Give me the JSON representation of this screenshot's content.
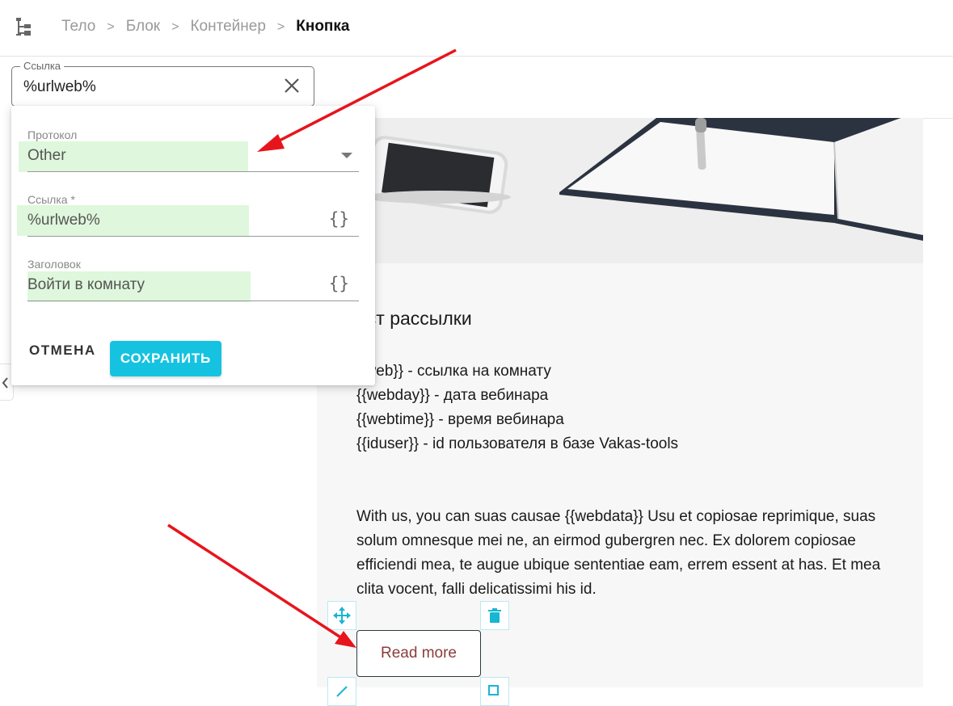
{
  "breadcrumb": {
    "items": [
      "Тело",
      "Блок",
      "Контейнер"
    ],
    "current": "Кнопка",
    "separator": ">"
  },
  "link_field": {
    "legend": "Ссылка",
    "value": "%urlweb%"
  },
  "popup": {
    "protocol": {
      "label": "Протокол",
      "value": "Other"
    },
    "link": {
      "label": "Ссылка *",
      "value": "%urlweb%",
      "brace": "{}"
    },
    "title": {
      "label": "Заголовок",
      "value": "Войти в комнату",
      "brace": "{}"
    },
    "cancel_label": "ОТМЕНА",
    "save_label": "СОХРАНИТЬ"
  },
  "content": {
    "heading": "ест рассылки",
    "vars": [
      "rlweb}} - ссылка на комнату",
      "{{webday}} - дата вебинара",
      "{{webtime}} - время вебинара",
      "{{iduser}} - id пользователя в базе Vakas-tools"
    ],
    "paragraph": "With us, you can suas causae {{webdata}} Usu et copiosae reprimique, suas solum omnesque mei ne, an eirmod gubergren nec. Ex dolorem copiosae efficiendi mea, te augue ubique sententiae eam, errem essent at has. Et mea clita vocent, falli delicatissimi his id.",
    "button_label": "Read more"
  },
  "colors": {
    "accent": "#15c3e0",
    "highlight": "#dff7dc",
    "annotation_arrow": "#e8141c",
    "button_text": "#8b3d3d"
  }
}
